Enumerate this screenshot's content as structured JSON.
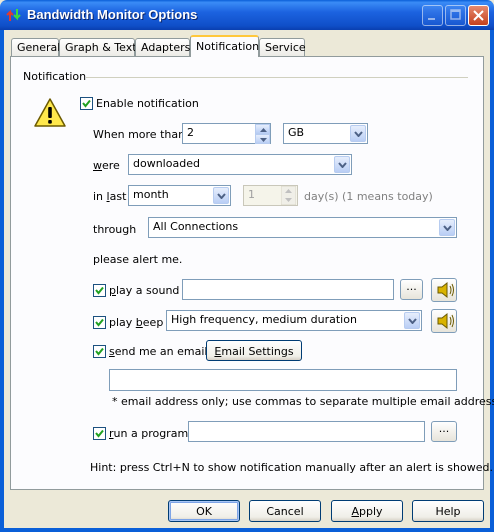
{
  "window": {
    "title": "Bandwidth Monitor Options",
    "icon": "bandwidth-arrows-icon",
    "controls": [
      "minimize-icon",
      "maximize-icon",
      "close-icon"
    ]
  },
  "tabs": [
    {
      "label": "General"
    },
    {
      "label": "Graph & Text"
    },
    {
      "label": "Adapters"
    },
    {
      "label": "Notification"
    },
    {
      "label": "Service"
    }
  ],
  "active_tab": "Notification",
  "notification": {
    "group_label": "Notification",
    "warning_icon": "warning-icon",
    "enable_label": "Enable notification",
    "enable_checked": true,
    "when_more_than_label": "When more than",
    "amount_value": "2",
    "unit_value": "GB",
    "were_label": "were",
    "direction_value": "downloaded",
    "in_last_label": "in last",
    "period_value": "month",
    "days_value": "1",
    "days_hint": "day(s) (1 means today)",
    "through_label": "through",
    "connection_value": "All Connections",
    "please_alert_label": "please alert me.",
    "play_sound": {
      "label": "play a sound",
      "checked": true,
      "value": "",
      "browse_label": "...",
      "icon": "speaker-icon"
    },
    "play_beep": {
      "label": "play beep",
      "checked": true,
      "value": "High frequency, medium duration",
      "icon": "speaker-icon"
    },
    "send_email": {
      "label": "send me an email",
      "checked": true,
      "settings_label": "Email Settings",
      "value": ""
    },
    "email_note": "* email address only; use commas to separate multiple email addresses",
    "run_program": {
      "label": "run a program",
      "checked": true,
      "value": "",
      "browse_label": "..."
    },
    "hint": "Hint: press Ctrl+N to show notification manually after an alert is showed."
  },
  "buttons": {
    "ok": "OK",
    "cancel": "Cancel",
    "apply": "Apply",
    "help": "Help"
  },
  "colors": {
    "title_bar": "#0A5FD8",
    "dialog_bg": "#ECE9D8",
    "panel_bg": "#FCFCFE",
    "active_tab_accent": "#FFC83C",
    "checkmark": "#21A121"
  }
}
